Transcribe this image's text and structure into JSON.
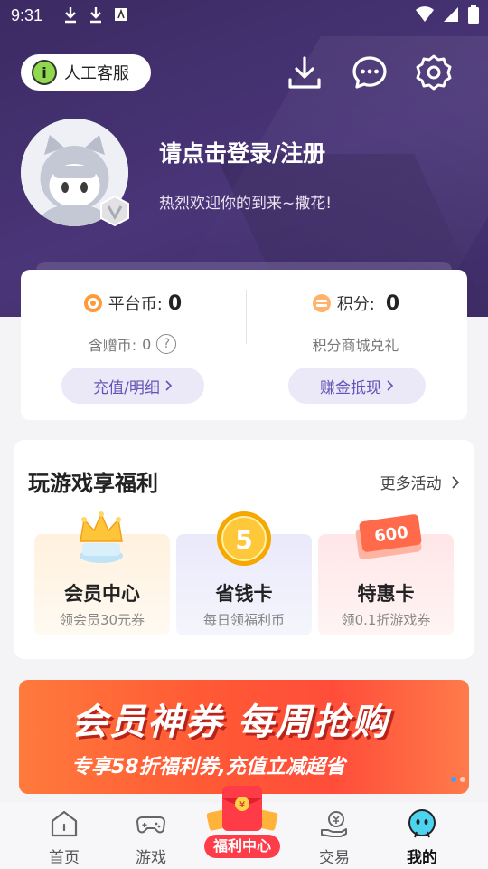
{
  "status_bar": {
    "time": "9:31"
  },
  "header": {
    "service_label": "人工客服",
    "login_title": "请点击登录/注册",
    "login_subtitle": "热烈欢迎你的到来~撒花!"
  },
  "wallet": {
    "platform_coin_label": "平台币:",
    "platform_coin_value": "0",
    "gift_coin_label": "含赠币:",
    "gift_coin_value": "0",
    "recharge_button": "充值/明细",
    "points_label": "积分:",
    "points_value": "0",
    "points_mall": "积分商城兑礼",
    "earn_button": "赚金抵现"
  },
  "benefits": {
    "title": "玩游戏享福利",
    "more": "更多活动",
    "cards": [
      {
        "name": "会员中心",
        "desc": "领会员30元券"
      },
      {
        "name": "省钱卡",
        "desc": "每日领福利币",
        "icon_text": "5"
      },
      {
        "name": "特惠卡",
        "desc": "领0.1折游戏券",
        "icon_text": "600"
      }
    ]
  },
  "banner": {
    "headline": "会员神券 每周抢购",
    "subline": "专享58折福利券,充值立减超省"
  },
  "bottom_nav": {
    "items": [
      "首页",
      "游戏",
      "福利中心",
      "交易",
      "我的"
    ],
    "active": "我的"
  },
  "colors": {
    "accent": "#6552b6",
    "header_bg": "#3b2a63",
    "banner": "#ff5a35"
  }
}
